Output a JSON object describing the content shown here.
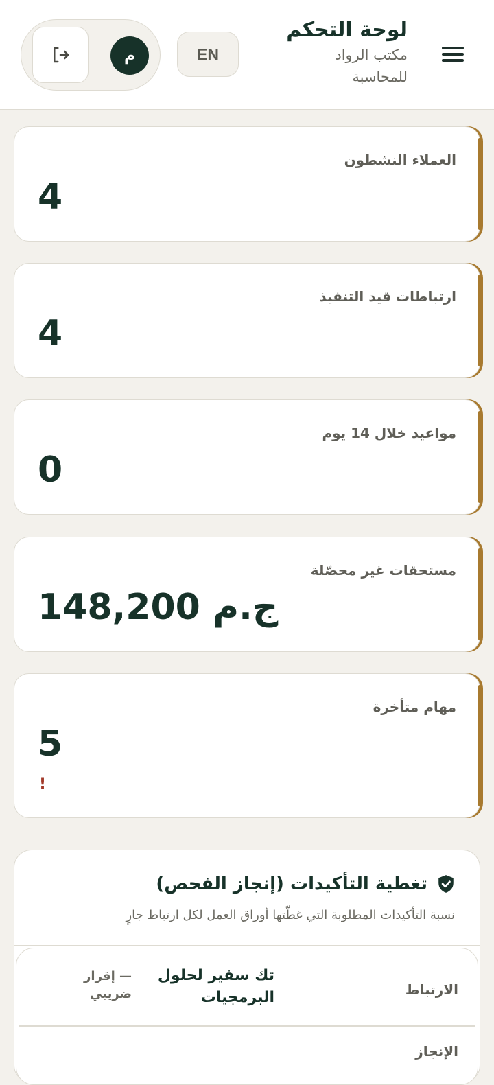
{
  "header": {
    "title": "لوحة التحكم",
    "office_name": "مكتب الرواد للمحاسبة",
    "lang_toggle": "EN",
    "avatar_initial": "م"
  },
  "stats": [
    {
      "label": "العملاء النشطون",
      "value": "4",
      "alert": ""
    },
    {
      "label": "ارتباطات قيد التنفيذ",
      "value": "4",
      "alert": ""
    },
    {
      "label": "مواعيد خلال 14 يوم",
      "value": "0",
      "alert": ""
    },
    {
      "label": "مستحقات غير محصّلة",
      "value": "148,200 ج.م",
      "alert": ""
    },
    {
      "label": "مهام متأخرة",
      "value": "5",
      "alert": "!"
    }
  ],
  "coverage": {
    "title": "تغطية التأكيدات (إنجاز الفحص)",
    "subtitle": "نسبة التأكيدات المطلوبة التي غطّتها أوراق العمل لكل ارتباط جارٍ",
    "engagement_label": "الارتباط",
    "client_name": "تك سفير لحلول البرمجيات",
    "engagement_type": "— إقرار ضريبي",
    "progress_label": "الإنجاز"
  },
  "colors": {
    "primary": "#173229",
    "accent": "#a87a2f",
    "background": "#f3f1ec",
    "alert": "#a33a2a"
  },
  "icons": [
    "menu-icon",
    "logout-icon",
    "shield-check-icon"
  ]
}
